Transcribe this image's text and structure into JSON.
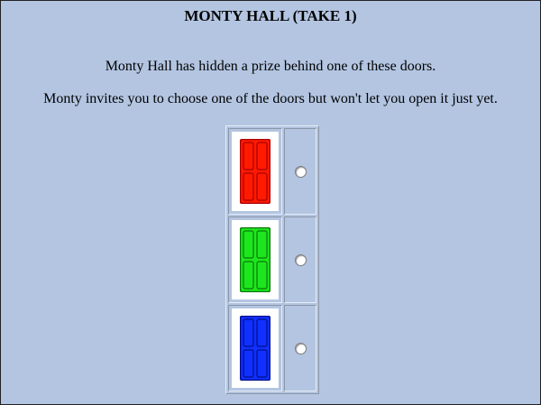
{
  "page": {
    "title": "MONTY HALL (TAKE 1)",
    "line1": "Monty Hall has hidden a prize behind one of these doors.",
    "line2": "Monty invites you to choose one of the doors but won't let you open it just yet."
  },
  "doors": [
    {
      "name": "red-door",
      "color": "#ff1a00",
      "dark": "#a80000",
      "selected": false
    },
    {
      "name": "green-door",
      "color": "#1ee61e",
      "dark": "#0a7a0a",
      "selected": false
    },
    {
      "name": "blue-door",
      "color": "#1030ff",
      "dark": "#00108a",
      "selected": false
    }
  ]
}
